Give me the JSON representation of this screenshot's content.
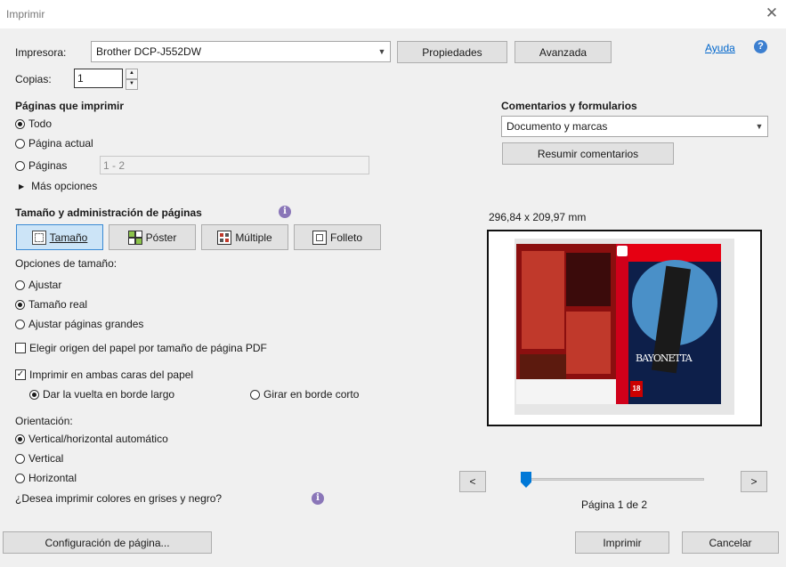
{
  "window": {
    "title": "Imprimir"
  },
  "printer": {
    "label": "Impresora:",
    "selected": "Brother DCP-J552DW",
    "properties_button": "Propiedades",
    "advanced_button": "Avanzada",
    "help_link": "Ayuda"
  },
  "copies": {
    "label": "Copias:",
    "value": "1"
  },
  "pages": {
    "heading": "Páginas que imprimir",
    "all": "Todo",
    "current": "Página actual",
    "pages_label": "Páginas",
    "pages_value": "1 - 2",
    "more": "Más opciones",
    "selected_option": "Todo"
  },
  "comments": {
    "heading": "Comentarios y formularios",
    "selected": "Documento y marcas",
    "summary_button": "Resumir comentarios"
  },
  "sizing": {
    "heading": "Tamaño y administración de páginas",
    "modes": [
      "Tamaño",
      "Póster",
      "Múltiple",
      "Folleto"
    ],
    "active_mode": "Tamaño",
    "options_label": "Opciones de tamaño:",
    "fit": "Ajustar",
    "actual": "Tamaño real",
    "shrink": "Ajustar páginas grandes",
    "choose_source": "Elegir origen del papel por tamaño de página PDF",
    "selected_option": "Tamaño real",
    "choose_source_checked": false
  },
  "duplex": {
    "label": "Imprimir en ambas caras del papel",
    "checked": true,
    "long_edge": "Dar la vuelta en borde largo",
    "short_edge": "Girar en borde corto",
    "selected": "Dar la vuelta en borde largo"
  },
  "orientation": {
    "label": "Orientación:",
    "auto": "Vertical/horizontal automático",
    "portrait": "Vertical",
    "landscape": "Horizontal",
    "selected": "Vertical/horizontal automático"
  },
  "grayscale": {
    "label": "¿Desea imprimir colores en grises y negro?"
  },
  "preview": {
    "dimensions": "296,84 x 209,97 mm",
    "page_indicator": "Página 1 de 2",
    "prev_button": "<",
    "next_button": ">",
    "slider_position": 0,
    "cover_text": "BAYONETTA",
    "rating": "18"
  },
  "footer": {
    "page_setup_button": "Configuración de página...",
    "print_button": "Imprimir",
    "cancel_button": "Cancelar"
  },
  "icons": {
    "help": "help-icon",
    "info": "info-icon",
    "close": "close-icon"
  },
  "colors": {
    "active_mode_bg": "#cce4f7",
    "link": "#0066cc",
    "help_icon": "#3c7fd0",
    "info_icon": "#8a76b8"
  }
}
